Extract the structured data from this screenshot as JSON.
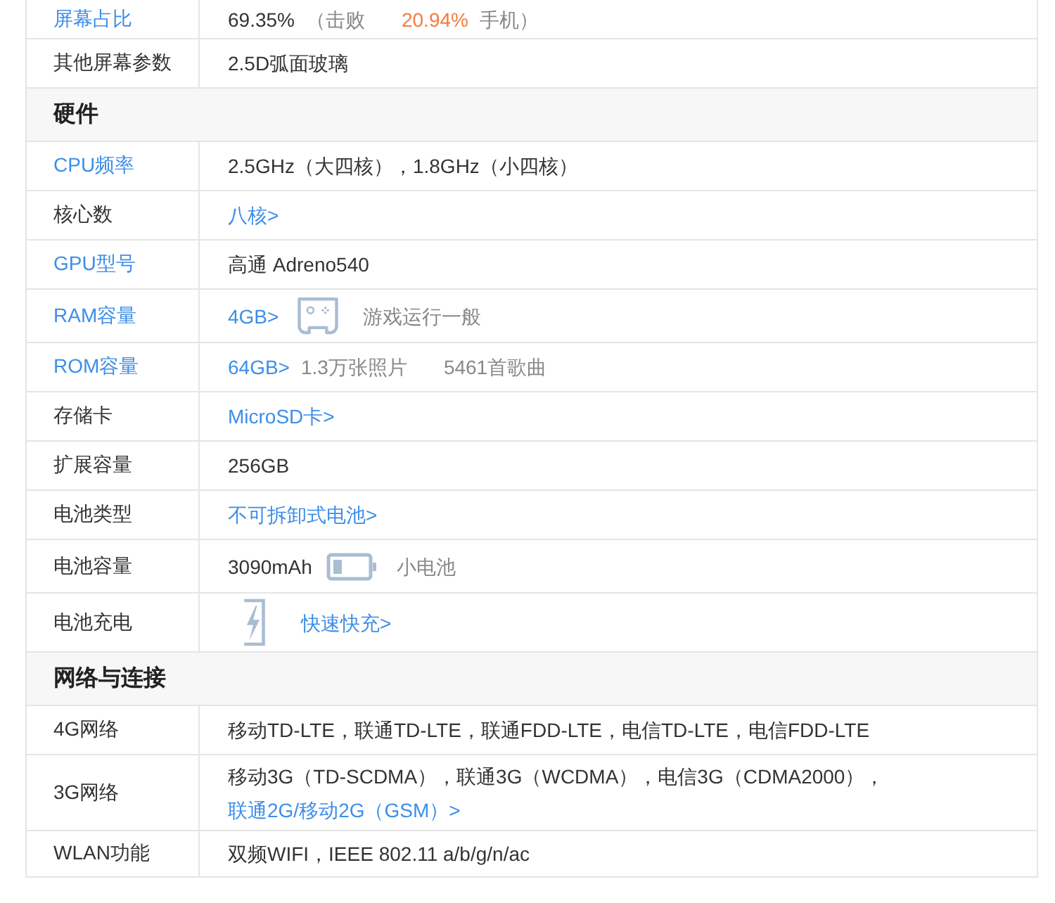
{
  "rows": [
    {
      "kind": "spec",
      "label": "屏幕占比",
      "label_link": true,
      "value": [
        {
          "kind": "text",
          "text": "69.35%"
        },
        {
          "kind": "note",
          "text": "（击败"
        },
        {
          "kind": "highlight",
          "text": "20.94%"
        },
        {
          "kind": "note",
          "text": "手机）"
        }
      ]
    },
    {
      "kind": "spec",
      "label": "其他屏幕参数",
      "label_link": false,
      "value": [
        {
          "kind": "text",
          "text": "2.5D弧面玻璃"
        }
      ]
    },
    {
      "kind": "section",
      "title": "硬件"
    },
    {
      "kind": "spec",
      "label": "CPU频率",
      "label_link": true,
      "value": [
        {
          "kind": "text",
          "text": "2.5GHz（大四核），1.8GHz（小四核）"
        }
      ]
    },
    {
      "kind": "spec",
      "label": "核心数",
      "label_link": false,
      "value": [
        {
          "kind": "link",
          "text": "八核>"
        }
      ]
    },
    {
      "kind": "spec",
      "label": "GPU型号",
      "label_link": true,
      "value": [
        {
          "kind": "text",
          "text": "高通 Adreno540"
        }
      ]
    },
    {
      "kind": "spec",
      "label": "RAM容量",
      "label_link": true,
      "value": [
        {
          "kind": "link",
          "text": "4GB>"
        },
        {
          "kind": "gamepad"
        },
        {
          "kind": "note",
          "text": "游戏运行一般"
        }
      ]
    },
    {
      "kind": "spec",
      "label": "ROM容量",
      "label_link": true,
      "value": [
        {
          "kind": "link",
          "text": "64GB>"
        },
        {
          "kind": "note",
          "text": "1.3万张照片"
        },
        {
          "kind": "note",
          "text": "5461首歌曲"
        }
      ]
    },
    {
      "kind": "spec",
      "label": "存储卡",
      "label_link": false,
      "value": [
        {
          "kind": "link",
          "text": "MicroSD卡>"
        }
      ]
    },
    {
      "kind": "spec",
      "label": "扩展容量",
      "label_link": false,
      "value": [
        {
          "kind": "text",
          "text": "256GB"
        }
      ]
    },
    {
      "kind": "spec",
      "label": "电池类型",
      "label_link": false,
      "value": [
        {
          "kind": "link",
          "text": "不可拆卸式电池>"
        }
      ]
    },
    {
      "kind": "spec",
      "label": "电池容量",
      "label_link": false,
      "value": [
        {
          "kind": "text",
          "text": "3090mAh"
        },
        {
          "kind": "battery"
        },
        {
          "kind": "note",
          "text": "小电池"
        }
      ]
    },
    {
      "kind": "spec",
      "label": "电池充电",
      "label_link": false,
      "value": [
        {
          "kind": "charging"
        },
        {
          "kind": "link",
          "text": "快速快充>"
        }
      ]
    },
    {
      "kind": "section",
      "title": "网络与连接"
    },
    {
      "kind": "spec",
      "label": "4G网络",
      "label_link": false,
      "value": [
        {
          "kind": "text",
          "text": "移动TD-LTE，联通TD-LTE，联通FDD-LTE，电信TD-LTE，电信FDD-LTE"
        }
      ]
    },
    {
      "kind": "spec",
      "label": "3G网络",
      "label_link": false,
      "value": [
        {
          "kind": "text",
          "text": "移动3G（TD-SCDMA），联通3G（WCDMA），电信3G（CDMA2000），"
        },
        {
          "kind": "link",
          "text": "联通2G/移动2G（GSM）>"
        }
      ]
    },
    {
      "kind": "spec",
      "label": "WLAN功能",
      "label_link": false,
      "value": [
        {
          "kind": "text",
          "text": "双频WIFI，IEEE 802.11 a/b/g/n/ac"
        }
      ]
    }
  ]
}
